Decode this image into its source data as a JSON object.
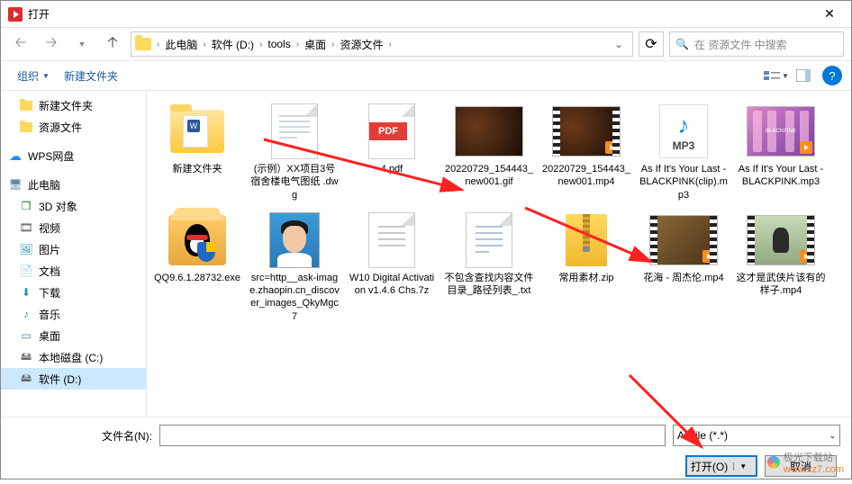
{
  "window": {
    "title": "打开"
  },
  "breadcrumb": [
    "此电脑",
    "软件 (D:)",
    "tools",
    "桌面",
    "资源文件"
  ],
  "search": {
    "placeholder": "在 资源文件 中搜索"
  },
  "toolbar": {
    "organize": "组织",
    "newfolder": "新建文件夹"
  },
  "sidebar": {
    "items": [
      {
        "label": "新建文件夹",
        "icon": "folder"
      },
      {
        "label": "资源文件",
        "icon": "folder"
      },
      {
        "label": "WPS网盘",
        "icon": "wps",
        "header": true
      },
      {
        "label": "此电脑",
        "icon": "pc",
        "header": true
      },
      {
        "label": "3D 对象",
        "icon": "3d"
      },
      {
        "label": "视频",
        "icon": "video"
      },
      {
        "label": "图片",
        "icon": "pic"
      },
      {
        "label": "文档",
        "icon": "doc"
      },
      {
        "label": "下载",
        "icon": "dl"
      },
      {
        "label": "音乐",
        "icon": "music"
      },
      {
        "label": "桌面",
        "icon": "desktop"
      },
      {
        "label": "本地磁盘 (C:)",
        "icon": "drive"
      },
      {
        "label": "软件 (D:)",
        "icon": "drive",
        "selected": true
      }
    ]
  },
  "files": [
    {
      "name": "新建文件夹",
      "thumb": "folder-doc"
    },
    {
      "name": "(示例）XX项目3号宿舍楼电气图纸 .dwg",
      "thumb": "dwg"
    },
    {
      "name": "4.pdf",
      "thumb": "pdf",
      "badge": "PDF"
    },
    {
      "name": "20220729_154443_new001.gif",
      "thumb": "img-dark"
    },
    {
      "name": "20220729_154443_new001.mp4",
      "thumb": "img-dark-video"
    },
    {
      "name": "As If It's Your Last - BLACKPINK(clip).mp3",
      "thumb": "mp3",
      "tag": "MP3"
    },
    {
      "name": "As If It's Your Last - BLACKPINK.mp3",
      "thumb": "pink-video",
      "pinklabel": "BLACKPINK"
    },
    {
      "name": "QQ9.6.1.28732.exe",
      "thumb": "qq-box"
    },
    {
      "name": "src=http__ask-image.zhaopin.cn_discover_images_QkyMgc7",
      "thumb": "photo"
    },
    {
      "name": "W10 Digital Activation v1.4.6 Chs.7z",
      "thumb": "7z"
    },
    {
      "name": "不包含查找内容文件目录_路径列表_.txt",
      "thumb": "txt"
    },
    {
      "name": "常用素材.zip",
      "thumb": "zip"
    },
    {
      "name": "花海 - 周杰伦.mp4",
      "thumb": "movie-video"
    },
    {
      "name": "这才是武侠片该有的样子.mp4",
      "thumb": "movie2-video"
    }
  ],
  "footer": {
    "filename_label": "文件名(N):",
    "filename_value": "",
    "filetype": "All file (*.*)",
    "open": "打开(O)",
    "cancel": "取消"
  },
  "watermark": {
    "text": "极光下载站",
    "url": "www.xz7.com"
  }
}
